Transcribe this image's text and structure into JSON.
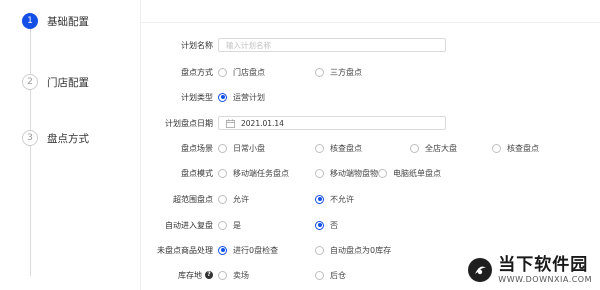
{
  "steps": [
    {
      "num": "1",
      "label": "基础配置",
      "active": true
    },
    {
      "num": "2",
      "label": "门店配置",
      "active": false
    },
    {
      "num": "3",
      "label": "盘点方式",
      "active": false
    }
  ],
  "form": {
    "plan_name": {
      "label": "计划名称",
      "placeholder": "输入计划名称"
    },
    "count_method": {
      "label": "盘点方式",
      "options": [
        "门店盘点",
        "三方盘点"
      ]
    },
    "plan_type": {
      "label": "计划类型",
      "options": [
        "运营计划"
      ]
    },
    "plan_date": {
      "label": "计划盘点日期",
      "value": "2021.01.14"
    },
    "scene": {
      "label": "盘点场景",
      "options": [
        "日常小盘",
        "核查盘点",
        "全店大盘",
        "核查盘点"
      ]
    },
    "mode": {
      "label": "盘点模式",
      "options": [
        "移动端任务盘点",
        "移动端物盘物",
        "电脑纸单盘点"
      ]
    },
    "over_range": {
      "label": "超范围盘点",
      "options": [
        "允许",
        "不允许"
      ]
    },
    "auto_review": {
      "label": "自动进入复盘",
      "options": [
        "是",
        "否"
      ]
    },
    "unchecked_goods": {
      "label": "未盘点商品处理",
      "options": [
        "进行0盘检查",
        "自动盘点为0库存"
      ]
    },
    "stock_location": {
      "label": "库存地",
      "options": [
        "卖场",
        "后仓"
      ]
    }
  },
  "watermark": {
    "title": "当下软件园",
    "url": "WWW.DOWNXIA.COM"
  },
  "colors": {
    "accent": "#1450e5"
  }
}
